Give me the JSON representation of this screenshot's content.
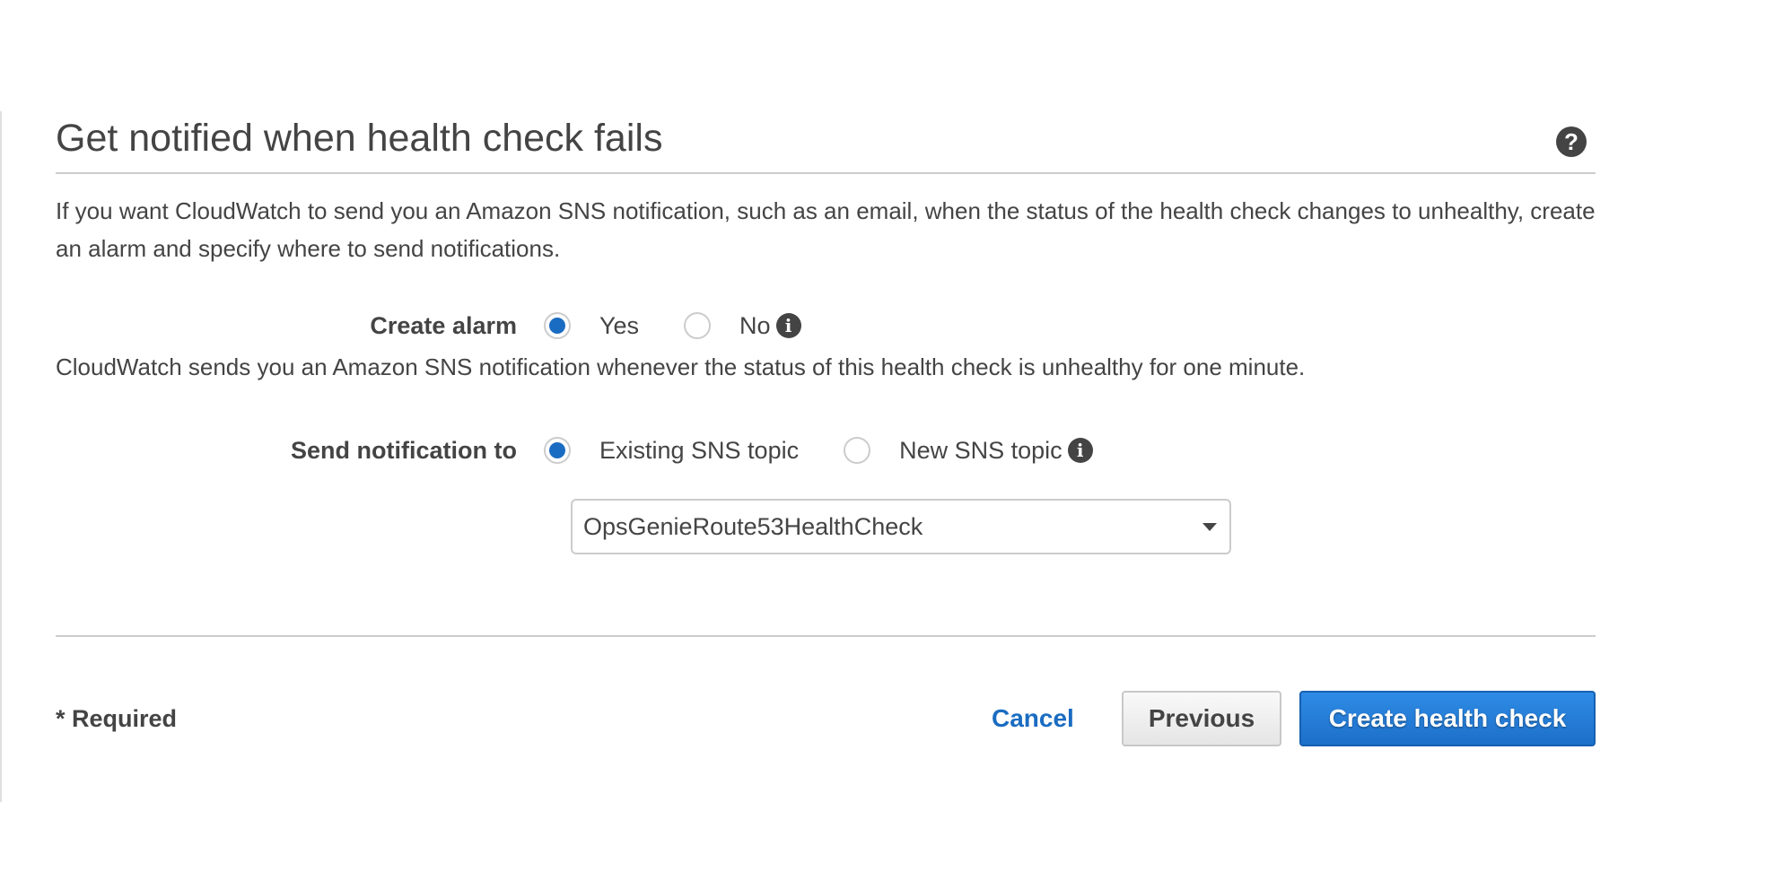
{
  "section": {
    "title": "Get notified when health check fails",
    "help_icon": "question-circle-icon",
    "description": "If you want CloudWatch to send you an Amazon SNS notification, such as an email, when the status of the health check changes to unhealthy, create an alarm and specify where to send notifications."
  },
  "create_alarm": {
    "label": "Create alarm",
    "options": [
      {
        "label": "Yes",
        "checked": true
      },
      {
        "label": "No",
        "checked": false
      }
    ],
    "info_icon": "info-circle-icon"
  },
  "note": "CloudWatch sends you an Amazon SNS notification whenever the status of this health check is unhealthy for one minute.",
  "send_notification": {
    "label": "Send notification to",
    "options": [
      {
        "label": "Existing SNS topic",
        "checked": true
      },
      {
        "label": "New SNS topic",
        "checked": false
      }
    ],
    "info_icon": "info-circle-icon",
    "selected_topic": "OpsGenieRoute53HealthCheck"
  },
  "footer": {
    "required_note": "* Required",
    "cancel_label": "Cancel",
    "previous_label": "Previous",
    "submit_label": "Create health check"
  },
  "colors": {
    "accent": "#1a6cc2",
    "primary_button": "#1d6fc9",
    "text": "#444444",
    "divider": "#cccccc"
  }
}
